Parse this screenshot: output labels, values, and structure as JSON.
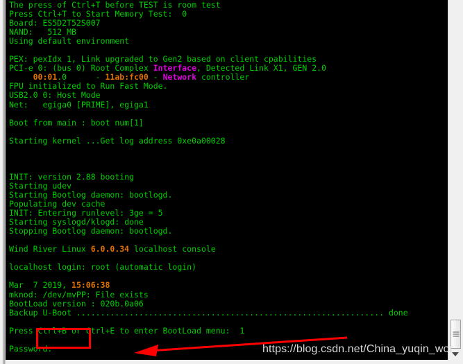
{
  "window": {
    "type": "serial-terminal-console",
    "background_color": "#000000",
    "text_color": "#00d000",
    "accent_orange": "#e07000",
    "accent_magenta": "#e000e0",
    "annotation_color": "#ff0000",
    "chrome_color": "#f0f0f0"
  },
  "terminal": {
    "lines": [
      {
        "id": "l1",
        "text": "The press of Ctrl+T before TEST is room test"
      },
      {
        "id": "l2",
        "text": "Press Ctrl+T to Start Memory Test:  0"
      },
      {
        "id": "l3",
        "text": "Board: ES5D2T52S007"
      },
      {
        "id": "l4",
        "text": "NAND:   512 MB"
      },
      {
        "id": "l5",
        "text": "Using default environment"
      },
      {
        "id": "l6",
        "text": ""
      },
      {
        "id": "l7",
        "text": "PEX: pexIdx 1, Link upgraded to Gen2 based on client cpabilities"
      },
      {
        "id": "l8",
        "text": "PCI-e 0: (bus 0) Root Complex Interface, Detected Link X1, GEN 2.0"
      },
      {
        "id": "l9",
        "text": "     00:01.0      - 11ab:fc00 - Network controller"
      },
      {
        "id": "l10",
        "text": "FPU initialized to Run Fast Mode."
      },
      {
        "id": "l11",
        "text": "USB2.0 0: Host Mode"
      },
      {
        "id": "l12",
        "text": "Net:   egiga0 [PRIME], egiga1"
      },
      {
        "id": "l13",
        "text": ""
      },
      {
        "id": "l14",
        "text": "Boot from main : boot num[1]"
      },
      {
        "id": "l15",
        "text": ""
      },
      {
        "id": "l16",
        "text": "Starting kernel ...Get log address 0xe0a00028"
      },
      {
        "id": "l17",
        "text": ""
      },
      {
        "id": "l18",
        "text": ""
      },
      {
        "id": "l19",
        "text": ""
      },
      {
        "id": "l20",
        "text": "INIT: version 2.88 booting"
      },
      {
        "id": "l21",
        "text": "Starting udev"
      },
      {
        "id": "l22",
        "text": "Starting Bootlog daemon: bootlogd."
      },
      {
        "id": "l23",
        "text": "Populating dev cache"
      },
      {
        "id": "l24",
        "text": "INIT: Entering runlevel: 3ge = 5"
      },
      {
        "id": "l25",
        "text": "Starting syslogd/klogd: done"
      },
      {
        "id": "l26",
        "text": "Stopping Bootlog daemon: bootlogd."
      },
      {
        "id": "l27",
        "text": ""
      },
      {
        "id": "l28",
        "text": "Wind River Linux 6.0.0.34 localhost console"
      },
      {
        "id": "l29",
        "text": ""
      },
      {
        "id": "l30",
        "text": "localhost login: root (automatic login)"
      },
      {
        "id": "l31",
        "text": ""
      },
      {
        "id": "l32",
        "text": "Mar  7 2019, 15:06:38"
      },
      {
        "id": "l33",
        "text": "mknod: /dev/mvPP: File exists"
      },
      {
        "id": "l34",
        "text": "BootLoad version : 020b.0a06"
      },
      {
        "id": "l35",
        "text": "Backup U-Boot ................................................ done"
      },
      {
        "id": "l36",
        "text": ""
      },
      {
        "id": "l37",
        "text": "Press Ctrl+B or Ctrl+E to enter BootLoad menu:  1"
      },
      {
        "id": "l38",
        "text": ""
      },
      {
        "id": "l39",
        "text": "Password:"
      }
    ],
    "segments": {
      "pci_line_prefix": "PCI-e 0: (bus 0) Root Complex ",
      "pci_interface": "Interface",
      "pci_line_suffix": ", Detected Link X1, GEN 2.0",
      "dev_indent": "     ",
      "dev_bdf_bold": "00:01",
      "dev_bdf_rest": ".0      - ",
      "dev_vendor": "11ab:fc00",
      "dev_dash": " - ",
      "dev_network": "Network",
      "dev_controller": " controller",
      "wr_prefix": "Wind River Linux ",
      "wr_version": "6.0.0.34",
      "wr_suffix": " localhost console",
      "date_prefix": "Mar  7 2019, ",
      "date_time": "15:06:38",
      "backup_label": "Backup U-Boot ",
      "backup_dots": "................................................................",
      "backup_done": " done",
      "press_prefix": "Press ",
      "press_highlight": "Ctrl+B or",
      "press_suffix": " Ctrl+E to enter BootLoad menu:  1",
      "password_prompt": "Password:"
    }
  },
  "scrollbar": {
    "orientation": "vertical",
    "position": "right",
    "thumb_position_percent": 89,
    "down_arrow_glyph": "down-arrow"
  },
  "annotations": {
    "highlight_box_label": "Ctrl+B or",
    "arrow_label": "points-to-password-prompt",
    "color": "#ff0000"
  },
  "watermark": {
    "text": "https://blog.csdn.net/China_yuqin_wor"
  }
}
